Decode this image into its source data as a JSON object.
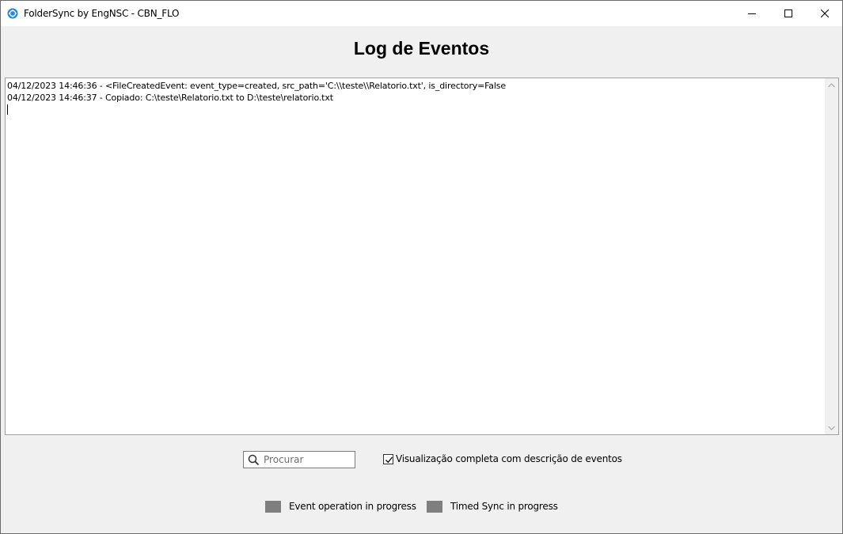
{
  "window": {
    "title": "FolderSync by EngNSC - CBN_FLO",
    "icon": "sync-gear-icon",
    "accent_color": "#1e88e5"
  },
  "heading": "Log de Eventos",
  "log": {
    "lines": [
      "04/12/2023 14:46:36 - <FileCreatedEvent: event_type=created, src_path='C:\\\\teste\\\\Relatorio.txt', is_directory=False",
      "04/12/2023 14:46:37 - Copiado: C:\\teste\\Relatorio.txt to D:\\teste\\relatorio.txt"
    ]
  },
  "search": {
    "placeholder": "Procurar",
    "value": ""
  },
  "full_view_checkbox": {
    "label": "Visualização completa com descrição de eventos",
    "checked": true
  },
  "indicators": [
    {
      "label": "Event operation in progress",
      "color": "#7f7f7f"
    },
    {
      "label": "Timed Sync in progress",
      "color": "#7f7f7f"
    }
  ]
}
